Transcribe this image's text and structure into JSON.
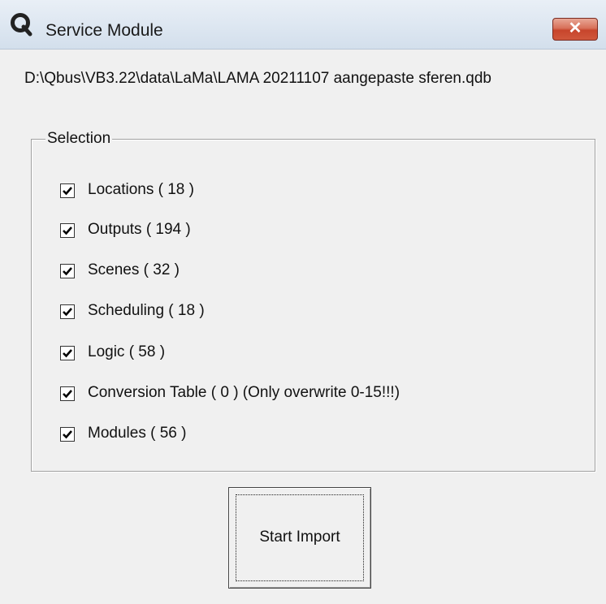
{
  "window": {
    "title": "Service Module",
    "icon": "q-app-icon",
    "close_label": "✕"
  },
  "file_path": "D:\\Qbus\\VB3.22\\data\\LaMa\\LAMA 20211107 aangepaste sferen.qdb",
  "selection": {
    "legend": "Selection",
    "items": [
      {
        "label": "Locations ( 18 )",
        "checked": true
      },
      {
        "label": "Outputs ( 194 )",
        "checked": true
      },
      {
        "label": "Scenes ( 32 )",
        "checked": true
      },
      {
        "label": "Scheduling ( 18 )",
        "checked": true
      },
      {
        "label": "Logic ( 58 )",
        "checked": true
      },
      {
        "label": "Conversion Table ( 0 ) (Only overwrite 0-15!!!)",
        "checked": true
      },
      {
        "label": "Modules ( 56 )",
        "checked": true
      }
    ]
  },
  "import_button": {
    "label": "Start Import"
  }
}
